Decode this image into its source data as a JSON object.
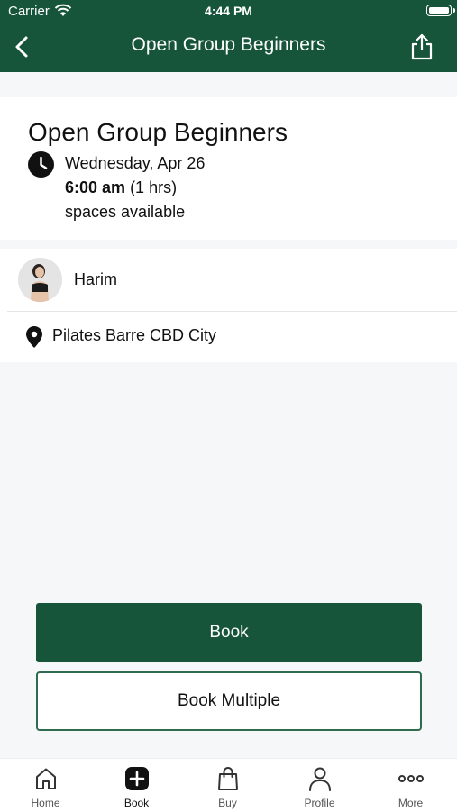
{
  "status_bar": {
    "carrier": "Carrier",
    "time": "4:44 PM"
  },
  "nav": {
    "title": "Open Group Beginners"
  },
  "class_info": {
    "title": "Open Group Beginners",
    "date": "Wednesday, Apr 26",
    "time": "6:00 am",
    "duration": "(1 hrs)",
    "spaces": "spaces available"
  },
  "instructor": {
    "name": "Harim"
  },
  "location": {
    "name": "Pilates Barre CBD City"
  },
  "actions": {
    "book_label": "Book",
    "book_multiple_label": "Book Multiple"
  },
  "tabs": [
    {
      "label": "Home",
      "icon": "home-icon"
    },
    {
      "label": "Book",
      "icon": "plus-square-icon",
      "active": true
    },
    {
      "label": "Buy",
      "icon": "shopping-bag-icon"
    },
    {
      "label": "Profile",
      "icon": "person-icon"
    },
    {
      "label": "More",
      "icon": "more-dots-icon"
    }
  ],
  "colors": {
    "brand": "#17553a",
    "background": "#f6f7f9"
  }
}
